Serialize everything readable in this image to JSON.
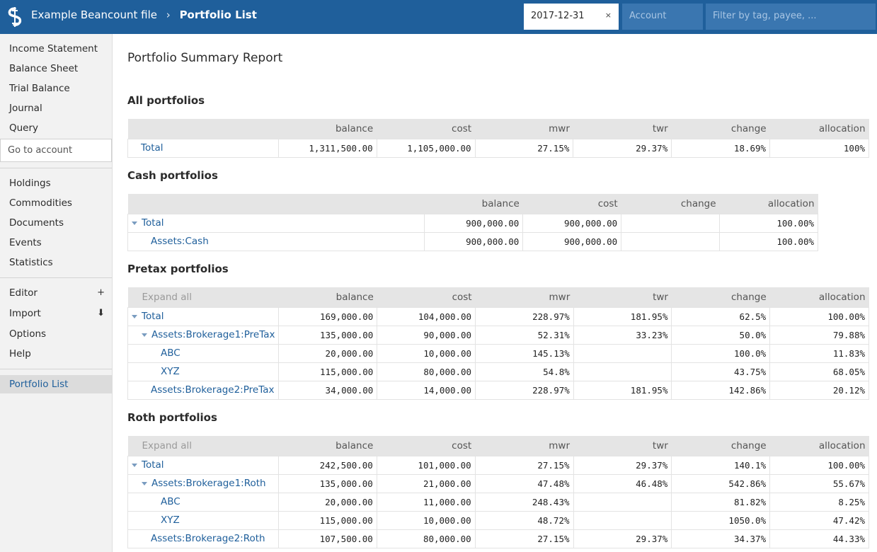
{
  "header": {
    "app_title": "Example Beancount file",
    "separator": "›",
    "page": "Portfolio List",
    "date_value": "2017-12-31",
    "clear_icon": "×",
    "account_placeholder": "Account",
    "filter_placeholder": "Filter by tag, payee, ..."
  },
  "sidebar": {
    "group1": [
      "Income Statement",
      "Balance Sheet",
      "Trial Balance",
      "Journal",
      "Query"
    ],
    "goto_account": "Go to account",
    "group2": [
      "Holdings",
      "Commodities",
      "Documents",
      "Events",
      "Statistics"
    ],
    "editor": "Editor",
    "editor_icon": "+",
    "import": "Import",
    "import_icon": "⬇",
    "options": "Options",
    "help": "Help",
    "portfolio_list": "Portfolio List"
  },
  "main": {
    "title": "Portfolio Summary Report",
    "all": {
      "title": "All portfolios",
      "headers": [
        "balance",
        "cost",
        "mwr",
        "twr",
        "change",
        "allocation"
      ],
      "rows": [
        {
          "name": "Total",
          "cells": [
            "1,311,500.00",
            "1,105,000.00",
            "27.15%",
            "29.37%",
            "18.69%",
            "100%"
          ]
        }
      ]
    },
    "cash": {
      "title": "Cash portfolios",
      "headers": [
        "balance",
        "cost",
        "change",
        "allocation"
      ],
      "rows": [
        {
          "name": "Total",
          "cells": [
            "900,000.00",
            "900,000.00",
            "",
            "100.00%"
          ]
        },
        {
          "name": "Assets:Cash",
          "cells": [
            "900,000.00",
            "900,000.00",
            "",
            "100.00%"
          ]
        }
      ]
    },
    "pretax": {
      "title": "Pretax portfolios",
      "expand_all": "Expand all",
      "headers": [
        "balance",
        "cost",
        "mwr",
        "twr",
        "change",
        "allocation"
      ],
      "rows": [
        {
          "name": "Total",
          "cells": [
            "169,000.00",
            "104,000.00",
            "228.97%",
            "181.95%",
            "62.5%",
            "100.00%"
          ]
        },
        {
          "name": "Assets:Brokerage1:PreTax",
          "cells": [
            "135,000.00",
            "90,000.00",
            "52.31%",
            "33.23%",
            "50.0%",
            "79.88%"
          ]
        },
        {
          "name": "ABC",
          "cells": [
            "20,000.00",
            "10,000.00",
            "145.13%",
            "",
            "100.0%",
            "11.83%"
          ]
        },
        {
          "name": "XYZ",
          "cells": [
            "115,000.00",
            "80,000.00",
            "54.8%",
            "",
            "43.75%",
            "68.05%"
          ]
        },
        {
          "name": "Assets:Brokerage2:PreTax",
          "cells": [
            "34,000.00",
            "14,000.00",
            "228.97%",
            "181.95%",
            "142.86%",
            "20.12%"
          ]
        }
      ]
    },
    "roth": {
      "title": "Roth portfolios",
      "expand_all": "Expand all",
      "headers": [
        "balance",
        "cost",
        "mwr",
        "twr",
        "change",
        "allocation"
      ],
      "rows": [
        {
          "name": "Total",
          "cells": [
            "242,500.00",
            "101,000.00",
            "27.15%",
            "29.37%",
            "140.1%",
            "100.00%"
          ]
        },
        {
          "name": "Assets:Brokerage1:Roth",
          "cells": [
            "135,000.00",
            "21,000.00",
            "47.48%",
            "46.48%",
            "542.86%",
            "55.67%"
          ]
        },
        {
          "name": "ABC",
          "cells": [
            "20,000.00",
            "11,000.00",
            "248.43%",
            "",
            "81.82%",
            "8.25%"
          ]
        },
        {
          "name": "XYZ",
          "cells": [
            "115,000.00",
            "10,000.00",
            "48.72%",
            "",
            "1050.0%",
            "47.42%"
          ]
        },
        {
          "name": "Assets:Brokerage2:Roth",
          "cells": [
            "107,500.00",
            "80,000.00",
            "27.15%",
            "29.37%",
            "34.37%",
            "44.33%"
          ]
        }
      ]
    }
  }
}
